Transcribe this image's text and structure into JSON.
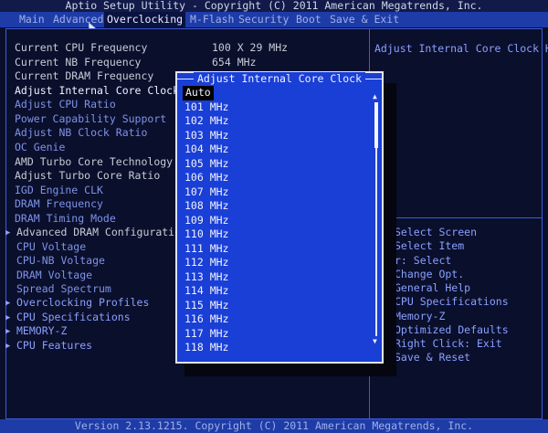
{
  "title": "Aptio Setup Utility - Copyright (C) 2011 American Megatrends, Inc.",
  "menu": {
    "items": [
      {
        "label": "Main"
      },
      {
        "label": "Advanced"
      },
      {
        "label": "Overclocking",
        "active": true
      },
      {
        "label": "M-Flash"
      },
      {
        "label": "Security"
      },
      {
        "label": "Boot"
      },
      {
        "label": "Save & Exit"
      }
    ]
  },
  "settings": [
    {
      "label": "Current CPU Frequency",
      "value": "100 X 29 MHz",
      "kind": "info"
    },
    {
      "label": "Current NB Frequency",
      "value": "654 MHz",
      "kind": "info"
    },
    {
      "label": "Current DRAM Frequency",
      "value": "",
      "kind": "info"
    },
    {
      "label": "Adjust Internal Core Clock",
      "kind": "selected"
    },
    {
      "label": "Adjust CPU Ratio",
      "kind": "opt"
    },
    {
      "label": "Power Capability Support",
      "kind": "opt"
    },
    {
      "label": "Adjust NB Clock Ratio",
      "kind": "opt"
    },
    {
      "label": "OC Genie",
      "kind": "opt"
    },
    {
      "label": "AMD Turbo Core Technology",
      "kind": "info"
    },
    {
      "label": "Adjust Turbo Core Ratio",
      "kind": "info"
    },
    {
      "label": "IGD Engine CLK",
      "kind": "opt"
    },
    {
      "label": "DRAM Frequency",
      "kind": "opt"
    },
    {
      "label": "DRAM Timing Mode",
      "kind": "opt"
    },
    {
      "label": "Advanced DRAM Configuration",
      "kind": "info",
      "submenu": true
    },
    {
      "label": "CPU Voltage",
      "kind": "opt"
    },
    {
      "label": "CPU-NB Voltage",
      "kind": "opt"
    },
    {
      "label": "DRAM Voltage",
      "kind": "opt"
    },
    {
      "label": "Spread Spectrum",
      "kind": "opt"
    },
    {
      "label": "Overclocking Profiles",
      "kind": "sub",
      "submenu": true
    },
    {
      "label": "CPU Specifications",
      "kind": "sub",
      "submenu": true
    },
    {
      "label": "MEMORY-Z",
      "kind": "sub",
      "submenu": true
    },
    {
      "label": "CPU Features",
      "kind": "sub",
      "submenu": true
    }
  ],
  "help_text": "Adjust Internal Core Clock Help",
  "keys": [
    "Select Screen",
    "Select Item",
    "r: Select",
    " Change Opt.",
    "General Help",
    "CPU Specifications",
    "Memory-Z",
    "Optimized Defaults",
    "Right Click: Exit",
    " Save & Reset"
  ],
  "popup": {
    "title": "Adjust Internal Core Clock",
    "options": [
      "Auto",
      "101 MHz",
      "102 MHz",
      "103 MHz",
      "104 MHz",
      "105 MHz",
      "106 MHz",
      "107 MHz",
      "108 MHz",
      "109 MHz",
      "110 MHz",
      "111 MHz",
      "112 MHz",
      "113 MHz",
      "114 MHz",
      "115 MHz",
      "116 MHz",
      "117 MHz",
      "118 MHz"
    ],
    "selected_index": 0,
    "scroll_up_icon": "triangle-up-icon",
    "scroll_down_icon": "triangle-down-icon"
  },
  "footer": "Version 2.13.1215. Copyright (C) 2011 American Megatrends, Inc.",
  "colors": {
    "background": "#0a0f2c",
    "menu_bar": "#1e3ca8",
    "popup": "#1a3fd6",
    "text_white": "#f0f2ff",
    "text_blue": "#8aa0ff"
  }
}
